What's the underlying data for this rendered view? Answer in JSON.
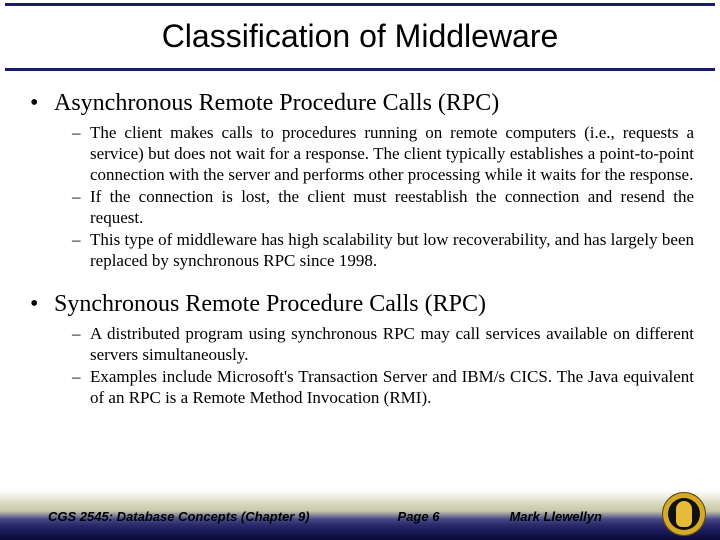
{
  "title": "Classification of Middleware",
  "sections": [
    {
      "heading": "Asynchronous Remote Procedure Calls (RPC)",
      "items": [
        "The client makes calls to procedures running on remote computers (i.e., requests a service) but does not wait for a response.  The client typically establishes a point-to-point connection with the server and performs other processing while it waits for the response.",
        "If the connection is lost, the client must reestablish the connection and resend the request.",
        "This type of middleware has high scalability but low recoverability, and has largely been replaced by synchronous RPC since 1998."
      ]
    },
    {
      "heading": "Synchronous Remote Procedure Calls (RPC)",
      "items": [
        "A distributed program using synchronous RPC may call services available on different servers simultaneously.",
        "Examples include Microsoft's Transaction Server and IBM/s CICS.  The Java equivalent of an RPC is a Remote Method Invocation (RMI)."
      ]
    }
  ],
  "footer": {
    "course": "CGS 2545: Database Concepts  (Chapter 9)",
    "page": "Page 6",
    "author": "Mark Llewellyn"
  }
}
